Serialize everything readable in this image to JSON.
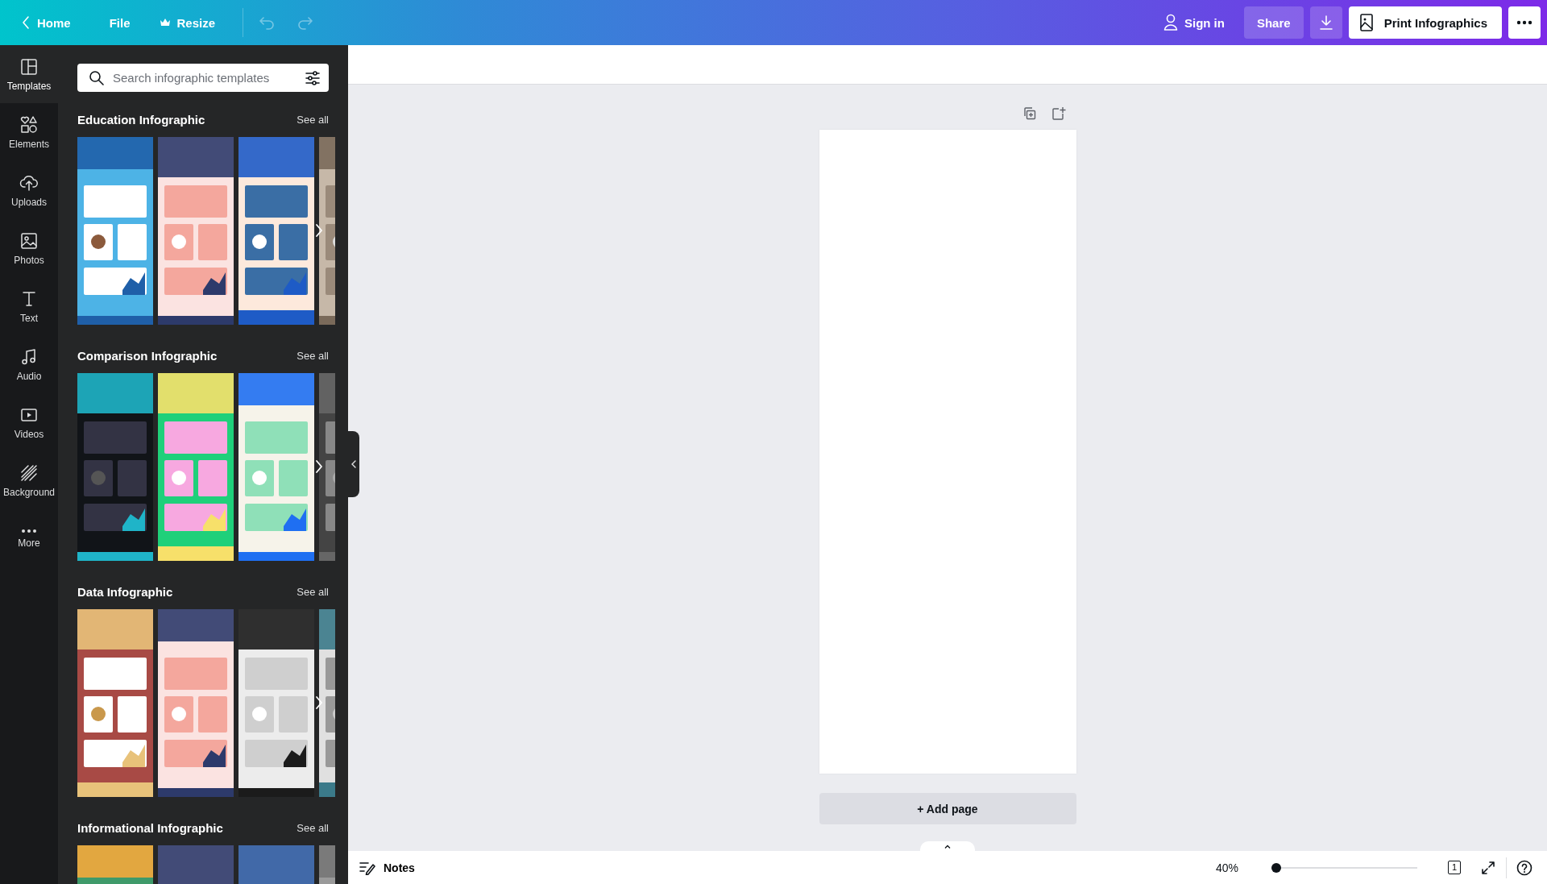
{
  "top_bar": {
    "back_label": "Home",
    "menu": [
      {
        "label": "File",
        "kind": "plain"
      },
      {
        "label": "Resize",
        "kind": "crown"
      }
    ],
    "history": [
      {
        "kind": "undo",
        "disabled": true
      },
      {
        "kind": "redo",
        "disabled": true
      }
    ],
    "sign_in": "Sign in",
    "share": "Share",
    "print": "Print Infographics"
  },
  "rail": [
    {
      "label": "Templates",
      "kind": "templates",
      "selected": true
    },
    {
      "label": "Elements",
      "kind": "elements",
      "selected": false
    },
    {
      "label": "Uploads",
      "kind": "uploads",
      "selected": false
    },
    {
      "label": "Photos",
      "kind": "photos",
      "selected": false
    },
    {
      "label": "Text",
      "kind": "text",
      "selected": false
    },
    {
      "label": "Audio",
      "kind": "audio",
      "selected": false
    },
    {
      "label": "Videos",
      "kind": "videos",
      "selected": false
    },
    {
      "label": "Background",
      "kind": "background",
      "selected": false
    },
    {
      "label": "More",
      "kind": "more",
      "selected": false
    }
  ],
  "search": {
    "placeholder": "Search infographic templates"
  },
  "sections": [
    {
      "title": "Education Infographic",
      "see_all": "See all"
    },
    {
      "title": "Comparison Infographic",
      "see_all": "See all"
    },
    {
      "title": "Data Infographic",
      "see_all": "See all"
    },
    {
      "title": "Informational Infographic",
      "see_all": "See all"
    }
  ],
  "canvas": {
    "add_page": "+ Add page"
  },
  "bottom_bar": {
    "notes": "Notes",
    "zoom": "40%",
    "zoom_slider": {
      "level": 0.03
    },
    "page_count": "1"
  }
}
